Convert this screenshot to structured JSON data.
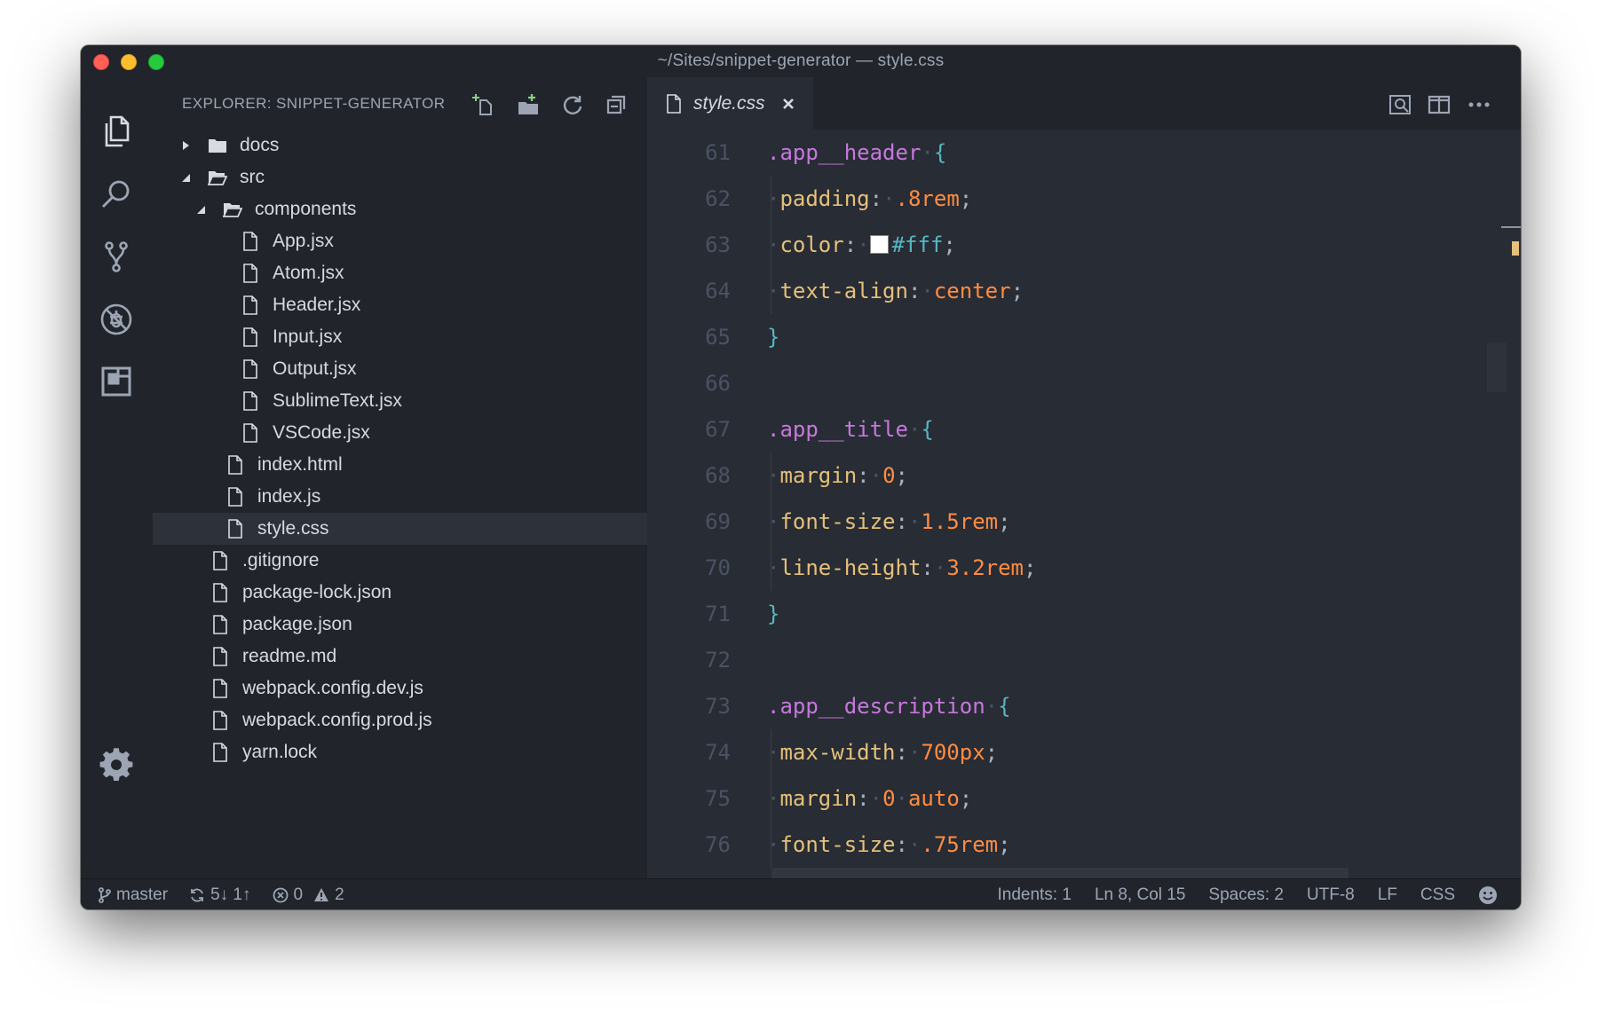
{
  "window": {
    "title": "~/Sites/snippet-generator — style.css"
  },
  "activity_bar": {
    "items": [
      "files-icon",
      "search-icon",
      "source-control-icon",
      "debug-icon",
      "extensions-icon"
    ],
    "bottom": "gear-icon"
  },
  "sidebar": {
    "title": "EXPLORER: SNIPPET-GENERATOR",
    "actions": [
      "new-file-icon",
      "new-folder-icon",
      "refresh-icon",
      "collapse-all-icon"
    ],
    "tree": [
      {
        "label": "docs",
        "type": "folder",
        "state": "collapsed",
        "depth": 0
      },
      {
        "label": "src",
        "type": "folder",
        "state": "expanded",
        "depth": 0
      },
      {
        "label": "components",
        "type": "folder",
        "state": "expanded",
        "depth": 1
      },
      {
        "label": "App.jsx",
        "type": "file",
        "depth": 2
      },
      {
        "label": "Atom.jsx",
        "type": "file",
        "depth": 2
      },
      {
        "label": "Header.jsx",
        "type": "file",
        "depth": 2
      },
      {
        "label": "Input.jsx",
        "type": "file",
        "depth": 2
      },
      {
        "label": "Output.jsx",
        "type": "file",
        "depth": 2
      },
      {
        "label": "SublimeText.jsx",
        "type": "file",
        "depth": 2
      },
      {
        "label": "VSCode.jsx",
        "type": "file",
        "depth": 2
      },
      {
        "label": "index.html",
        "type": "file",
        "depth": 1
      },
      {
        "label": "index.js",
        "type": "file",
        "depth": 1
      },
      {
        "label": "style.css",
        "type": "file",
        "depth": 1,
        "selected": true
      },
      {
        "label": ".gitignore",
        "type": "file",
        "depth": 0
      },
      {
        "label": "package-lock.json",
        "type": "file",
        "depth": 0
      },
      {
        "label": "package.json",
        "type": "file",
        "depth": 0
      },
      {
        "label": "readme.md",
        "type": "file",
        "depth": 0
      },
      {
        "label": "webpack.config.dev.js",
        "type": "file",
        "depth": 0
      },
      {
        "label": "webpack.config.prod.js",
        "type": "file",
        "depth": 0
      },
      {
        "label": "yarn.lock",
        "type": "file",
        "depth": 0
      }
    ]
  },
  "editor": {
    "tab": {
      "label": "style.css"
    },
    "actions": [
      "open-preview-icon",
      "split-editor-icon",
      "more-icon"
    ],
    "lines": [
      {
        "n": "61",
        "indent": 0,
        "tokens": [
          [
            "sel",
            ".app__header"
          ],
          [
            "dot",
            "·"
          ],
          [
            "brace",
            "{"
          ]
        ]
      },
      {
        "n": "62",
        "indent": 1,
        "tokens": [
          [
            "prop",
            "padding"
          ],
          [
            "punc",
            ":"
          ],
          [
            "dot",
            "·"
          ],
          [
            "num",
            ".8rem"
          ],
          [
            "punc",
            ";"
          ]
        ]
      },
      {
        "n": "63",
        "indent": 1,
        "tokens": [
          [
            "prop",
            "color"
          ],
          [
            "punc",
            ":"
          ],
          [
            "dot",
            "·"
          ],
          [
            "swatch",
            "#ffffff"
          ],
          [
            "colr",
            "#fff"
          ],
          [
            "punc",
            ";"
          ]
        ]
      },
      {
        "n": "64",
        "indent": 1,
        "tokens": [
          [
            "prop",
            "text-align"
          ],
          [
            "punc",
            ":"
          ],
          [
            "dot",
            "·"
          ],
          [
            "kw",
            "center"
          ],
          [
            "punc",
            ";"
          ]
        ]
      },
      {
        "n": "65",
        "indent": 0,
        "tokens": [
          [
            "brace",
            "}"
          ]
        ]
      },
      {
        "n": "66",
        "indent": 0,
        "tokens": []
      },
      {
        "n": "67",
        "indent": 0,
        "tokens": [
          [
            "sel",
            ".app__title"
          ],
          [
            "dot",
            "·"
          ],
          [
            "brace",
            "{"
          ]
        ]
      },
      {
        "n": "68",
        "indent": 1,
        "tokens": [
          [
            "prop",
            "margin"
          ],
          [
            "punc",
            ":"
          ],
          [
            "dot",
            "·"
          ],
          [
            "num",
            "0"
          ],
          [
            "punc",
            ";"
          ]
        ]
      },
      {
        "n": "69",
        "indent": 1,
        "tokens": [
          [
            "prop",
            "font-size"
          ],
          [
            "punc",
            ":"
          ],
          [
            "dot",
            "·"
          ],
          [
            "num",
            "1.5rem"
          ],
          [
            "punc",
            ";"
          ]
        ]
      },
      {
        "n": "70",
        "indent": 1,
        "tokens": [
          [
            "prop",
            "line-height"
          ],
          [
            "punc",
            ":"
          ],
          [
            "dot",
            "·"
          ],
          [
            "num",
            "3.2rem"
          ],
          [
            "punc",
            ";"
          ]
        ]
      },
      {
        "n": "71",
        "indent": 0,
        "tokens": [
          [
            "brace",
            "}"
          ]
        ]
      },
      {
        "n": "72",
        "indent": 0,
        "tokens": []
      },
      {
        "n": "73",
        "indent": 0,
        "tokens": [
          [
            "sel",
            ".app__description"
          ],
          [
            "dot",
            "·"
          ],
          [
            "brace",
            "{"
          ]
        ]
      },
      {
        "n": "74",
        "indent": 1,
        "tokens": [
          [
            "prop",
            "max-width"
          ],
          [
            "punc",
            ":"
          ],
          [
            "dot",
            "·"
          ],
          [
            "num",
            "700px"
          ],
          [
            "punc",
            ";"
          ]
        ]
      },
      {
        "n": "75",
        "indent": 1,
        "tokens": [
          [
            "prop",
            "margin"
          ],
          [
            "punc",
            ":"
          ],
          [
            "dot",
            "·"
          ],
          [
            "num",
            "0"
          ],
          [
            "dot",
            "·"
          ],
          [
            "kw",
            "auto"
          ],
          [
            "punc",
            ";"
          ]
        ]
      },
      {
        "n": "76",
        "indent": 1,
        "tokens": [
          [
            "prop",
            "font-size"
          ],
          [
            "punc",
            ":"
          ],
          [
            "dot",
            "·"
          ],
          [
            "num",
            ".75rem"
          ],
          [
            "punc",
            ";"
          ]
        ]
      }
    ]
  },
  "status_bar": {
    "branch": "master",
    "sync": "5↓ 1↑",
    "errors": "0",
    "warnings": "2",
    "indents": "Indents: 1",
    "position": "Ln 8, Col 15",
    "spaces": "Spaces: 2",
    "encoding": "UTF-8",
    "eol": "LF",
    "language": "CSS",
    "feedback_icon": "smiley-icon"
  },
  "colors": {
    "selector": "#c678dd",
    "property": "#e5c07b",
    "number": "#ff8c42",
    "brace": "#56b6c2",
    "background": "#282c34",
    "sidebar": "#21252b"
  }
}
